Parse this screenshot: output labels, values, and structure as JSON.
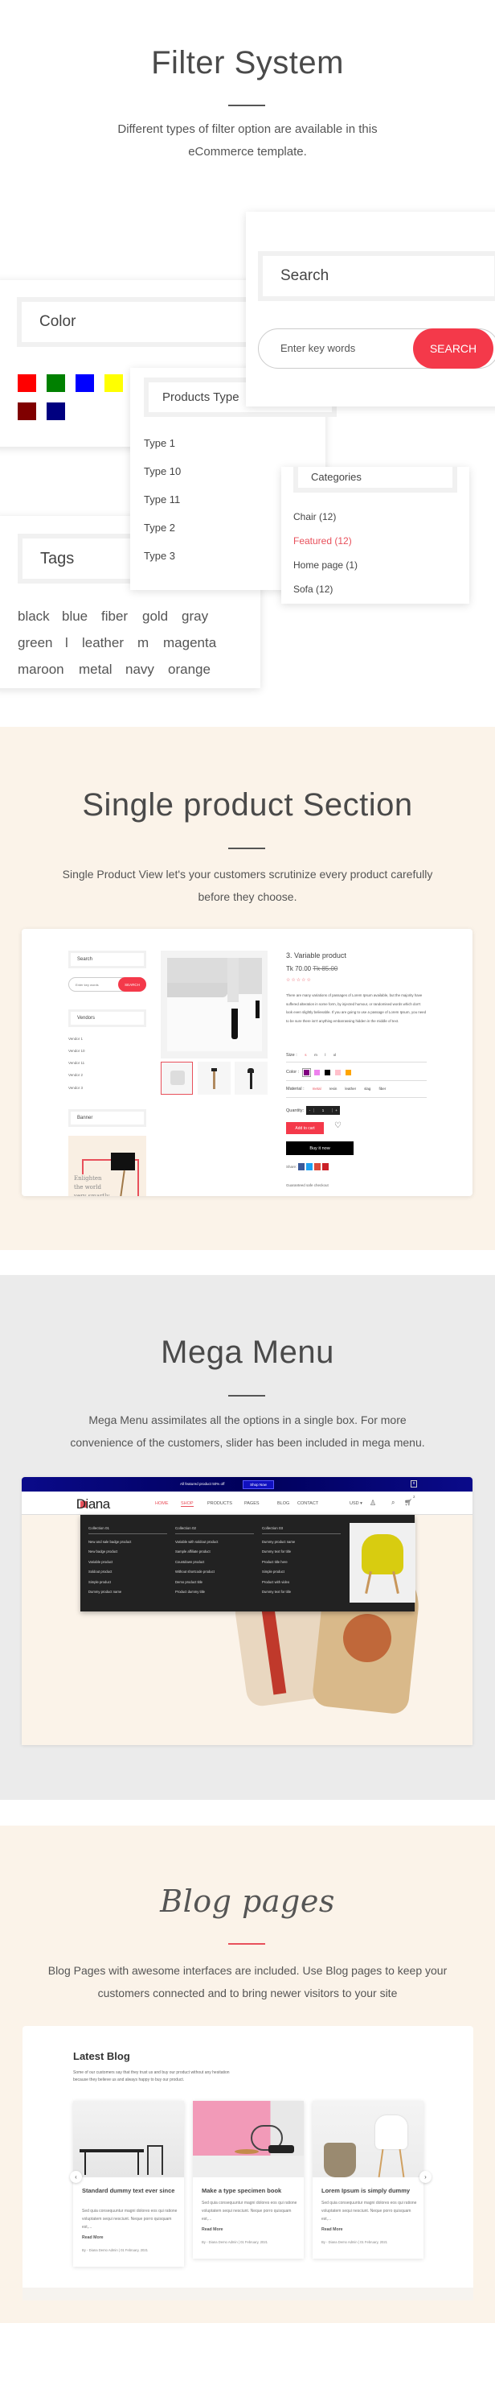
{
  "filter": {
    "title": "Filter System",
    "subtitle": "Different types of filter option are available in this eCommerce template.",
    "search": {
      "heading": "Search",
      "placeholder": "Enter key words",
      "button": "SEARCH"
    },
    "color": {
      "heading": "Color",
      "swatches": [
        "#ff0000",
        "#008000",
        "#0000ff",
        "#ffff00",
        "#800000",
        "#000080"
      ]
    },
    "products_type": {
      "heading": "Products Type",
      "items": [
        "Type 1",
        "Type 10",
        "Type 11",
        "Type 2",
        "Type 3"
      ]
    },
    "categories": {
      "heading": "Categories",
      "items": [
        "Chair (12)",
        "Featured (12)",
        "Home page (1)",
        "Sofa (12)"
      ],
      "active_color": "#e8505b"
    },
    "tags": {
      "heading": "Tags",
      "rows": [
        [
          "black",
          "blue",
          "fiber",
          "gold",
          "gray"
        ],
        [
          "green",
          "l",
          "leather",
          "m",
          "magenta"
        ],
        [
          "maroon",
          "metal",
          "navy",
          "orange"
        ]
      ]
    }
  },
  "single": {
    "title": "Single product Section",
    "subtitle": "Single Product View let's your customers scrutinize  every product carefully before they choose.",
    "sidebar": {
      "search_heading": "Search",
      "placeholder": "Enter key words",
      "button": "SEARCH",
      "vendors_heading": "Vendors",
      "vendors": [
        "Vendor 1",
        "Vendor 10",
        "Vendor 11",
        "Vendor 2",
        "Vendor 3"
      ],
      "banner_heading": "Banner",
      "banner_text": "Enlighten the world very smartly"
    },
    "product": {
      "title": "3. Variable product",
      "price": "Tk 70.00",
      "old_price": "Tk 85.00",
      "rating": 0,
      "description": "There are many variations of passages of Lorem Ipsum available, but the majority have suffered alteration in some form, by injected humour, or randomised words which don't look even slightly believable. If you are going to use a passage of Lorem Ipsum, you need to be sure there isn't anything embarrassing hidden in the middle of text.",
      "size_label": "Size :",
      "sizes": [
        "s",
        "m",
        "l",
        "xl"
      ],
      "color_label": "Color :",
      "colors": [
        "#800080",
        "#ee82ee",
        "#000000",
        "#ffc0cb",
        "#ffa500"
      ],
      "material_label": "Material :",
      "materials": [
        "metal",
        "resin",
        "leather",
        "slag",
        "fiber"
      ],
      "quantity_label": "Quantity:",
      "quantity": "1",
      "minus": "-",
      "plus": "+",
      "add_to_cart": "Add to cart",
      "buy_now": "Buy it now",
      "share_label": "Share:",
      "guarantee": "Guaranteed safe checkout"
    }
  },
  "mega": {
    "title": "Mega Menu",
    "subtitle": "Mega Menu assimilates all the options in a single box. For more convenience of the customers, slider has been included in mega menu.",
    "topbar": {
      "text": "All featured product 50% off",
      "button": "Shop Now",
      "close": "x"
    },
    "logo": "Diana",
    "nav": [
      "HOME",
      "SHOP",
      "PRODUCTS",
      "PAGES",
      "BLOG",
      "CONTACT"
    ],
    "currency": "USD",
    "cart_count": "2",
    "columns": [
      {
        "heading": "Collection 01",
        "items": [
          "New and sale badge product",
          "New badge product",
          "Variable product",
          "Soldout product",
          "Simple product",
          "Dummy product name"
        ]
      },
      {
        "heading": "Collection 02",
        "items": [
          "Variable with soldout product",
          "Sample affiliate product",
          "Countdown product",
          "Without shortcode product",
          "Demo product title",
          "Product dummy title"
        ]
      },
      {
        "heading": "Collection 03",
        "items": [
          "Dummy product name",
          "Dummy text for title",
          "Product title here",
          "Simple product",
          "Product with video",
          "Dummy text for title"
        ]
      }
    ]
  },
  "blog": {
    "title": "Blog pages",
    "subtitle": "Blog Pages with awesome interfaces are included. Use Blog pages to keep your customers connected and to bring newer visitors to your site",
    "heading": "Latest Blog",
    "intro": "Some of our customers say that they trust us and buy our product without any hesitation because they believe us and always happy to buy our product.",
    "posts": [
      {
        "title": "Standard dummy text ever since",
        "excerpt": "Sed quia consequuntur magni dolores eos qui ratione voluptatem sequi nesciunt. Neque porro quisquam est,...",
        "read_more": "Read More",
        "meta": "By - Diana Demo Admin   |   01 February, 2021"
      },
      {
        "title": "Make a type specimen book",
        "excerpt": "Sed quia consequuntur magni dolores eos qui ratione voluptatem sequi nesciunt. Neque porro quisquam est,...",
        "read_more": "Read More",
        "meta": "By - Diana Demo Admin   |   01 February, 2021"
      },
      {
        "title": "Lorem Ipsum is simply dummy",
        "excerpt": "Sed quia consequuntur magni dolores eos qui ratione voluptatem sequi nesciunt. Neque porro quisquam est,...",
        "read_more": "Read More",
        "meta": "By - Diana Demo Admin   |   01 February, 2021"
      }
    ]
  },
  "colors": {
    "accent": "#f4394a",
    "beige": "#fbf3e9",
    "gray_bg": "#ebebeb",
    "navy": "#000066"
  }
}
